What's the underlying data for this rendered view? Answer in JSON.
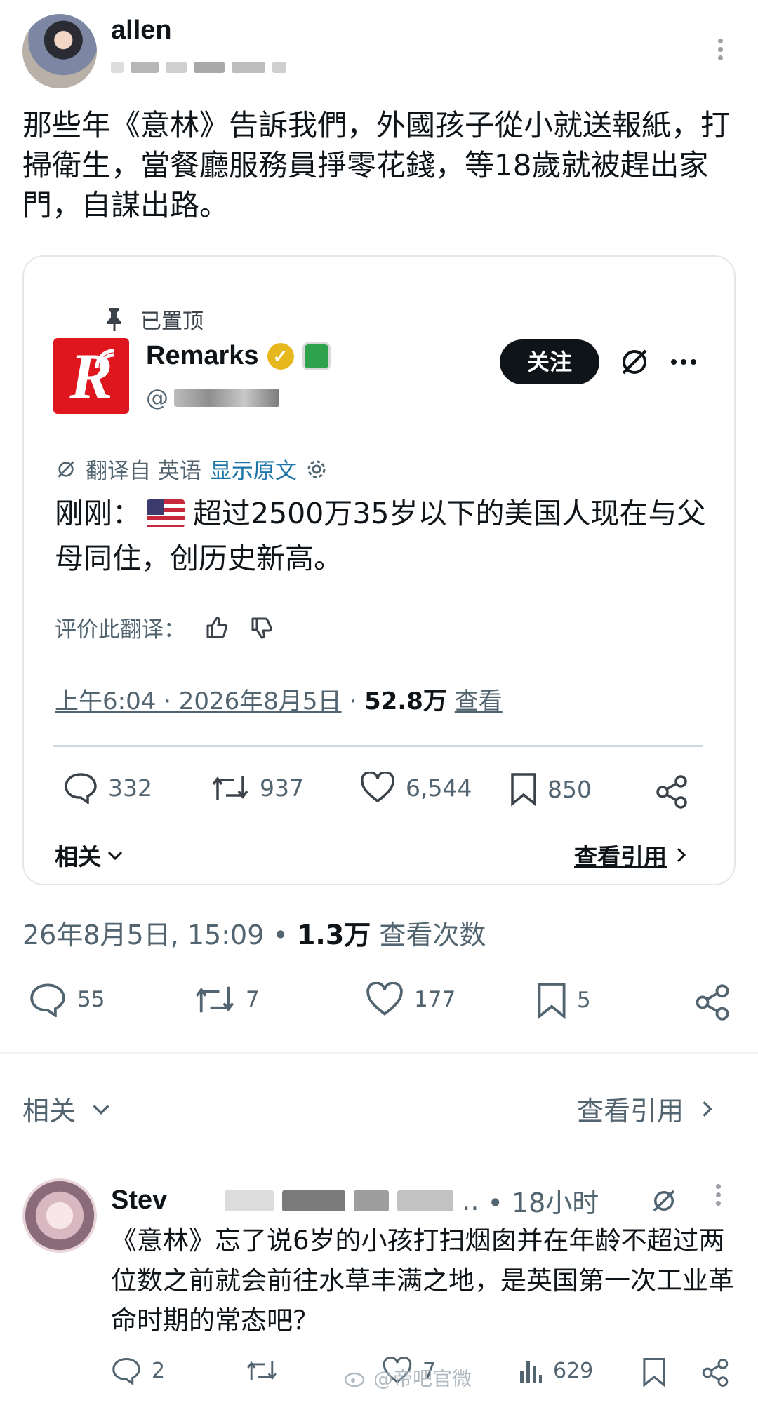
{
  "post": {
    "author": "allen",
    "text": "那些年《意林》告訴我們，外國孩子從小就送報紙，打掃衛生，當餐廳服務員掙零花錢，等18歲就被趕出家門，自謀出路。",
    "timestamp": "26年8月5日, 15:09 •",
    "views_count": "1.3万",
    "views_label": "查看次数",
    "actions": {
      "replies": "55",
      "reposts": "7",
      "likes": "177",
      "bookmarks": "5"
    },
    "related_label": "相关",
    "view_quotes_label": "查看引用"
  },
  "quoted": {
    "pinned_label": "已置顶",
    "logo_letter": "R",
    "name": "Remarks",
    "handle_prefix": "@",
    "follow_label": "关注",
    "translated_from": "翻译自 英语",
    "show_original": "显示原文",
    "text_prefix": "刚刚：",
    "text_body": "超过2500万35岁以下的美国人现在与父母同住，创历史新高。",
    "rate_label": "评价此翻译：",
    "time": "上午6:04 · 2026年8月5日",
    "dot": " · ",
    "views_count": "52.8万",
    "views_label": "查看",
    "actions": {
      "replies": "332",
      "reposts": "937",
      "likes": "6,544",
      "bookmarks": "850"
    },
    "related_label": "相关",
    "view_quotes_label": "查看引用"
  },
  "reply": {
    "name_partial": "Stev",
    "ellipsis": "..",
    "time": "• 18小时",
    "text": "《意林》忘了说6岁的小孩打扫烟囱并在年龄不超过两位数之前就会前往水草丰满之地，是英国第一次工业革命时期的常态吧？",
    "actions": {
      "replies": "2",
      "reposts": "",
      "likes": "7",
      "views": "629"
    }
  },
  "watermark": "@帝吧官微",
  "colors": {
    "text": "#0f1419",
    "muted": "#536471",
    "link": "#1d74a8",
    "logo_red": "#e0161e",
    "verified_gold": "#e7b81e"
  }
}
